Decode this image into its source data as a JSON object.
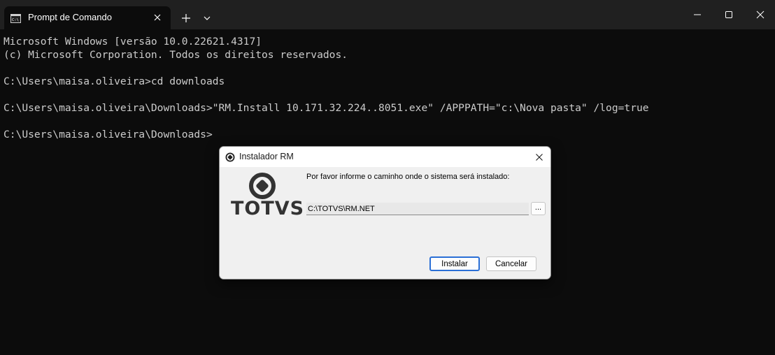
{
  "window": {
    "tab_title": "Prompt de Comando",
    "tab_icon": "cmd-icon",
    "tab_close_icon": "close-icon",
    "new_tab_icon": "plus-icon",
    "dropdown_icon": "chevron-down-icon",
    "controls": [
      "minimize-icon",
      "maximize-icon",
      "close-icon"
    ]
  },
  "console": {
    "lines": [
      "Microsoft Windows [versão 10.0.22621.4317]",
      "(c) Microsoft Corporation. Todos os direitos reservados.",
      "",
      "C:\\Users\\maisa.oliveira>cd downloads",
      "",
      "C:\\Users\\maisa.oliveira\\Downloads>\"RM.Install 10.171.32.224..8051.exe\" /APPPATH=\"c:\\Nova pasta\" /log=true",
      "",
      "C:\\Users\\maisa.oliveira\\Downloads>"
    ]
  },
  "dialog": {
    "title": "Instalador RM",
    "logo_text": "TOTVS",
    "prompt": "Por favor informe o caminho onde o sistema será instalado:",
    "path_value": "C:\\TOTVS\\RM.NET",
    "browse_label": "...",
    "install_label": "Instalar",
    "cancel_label": "Cancelar"
  },
  "colors": {
    "terminal_bg": "#0c0c0c",
    "titlebar_bg": "#202020",
    "terminal_text": "#cccccc",
    "dialog_bg": "#f0f0f0",
    "accent": "#2a6fd6",
    "logo": "#333333"
  }
}
